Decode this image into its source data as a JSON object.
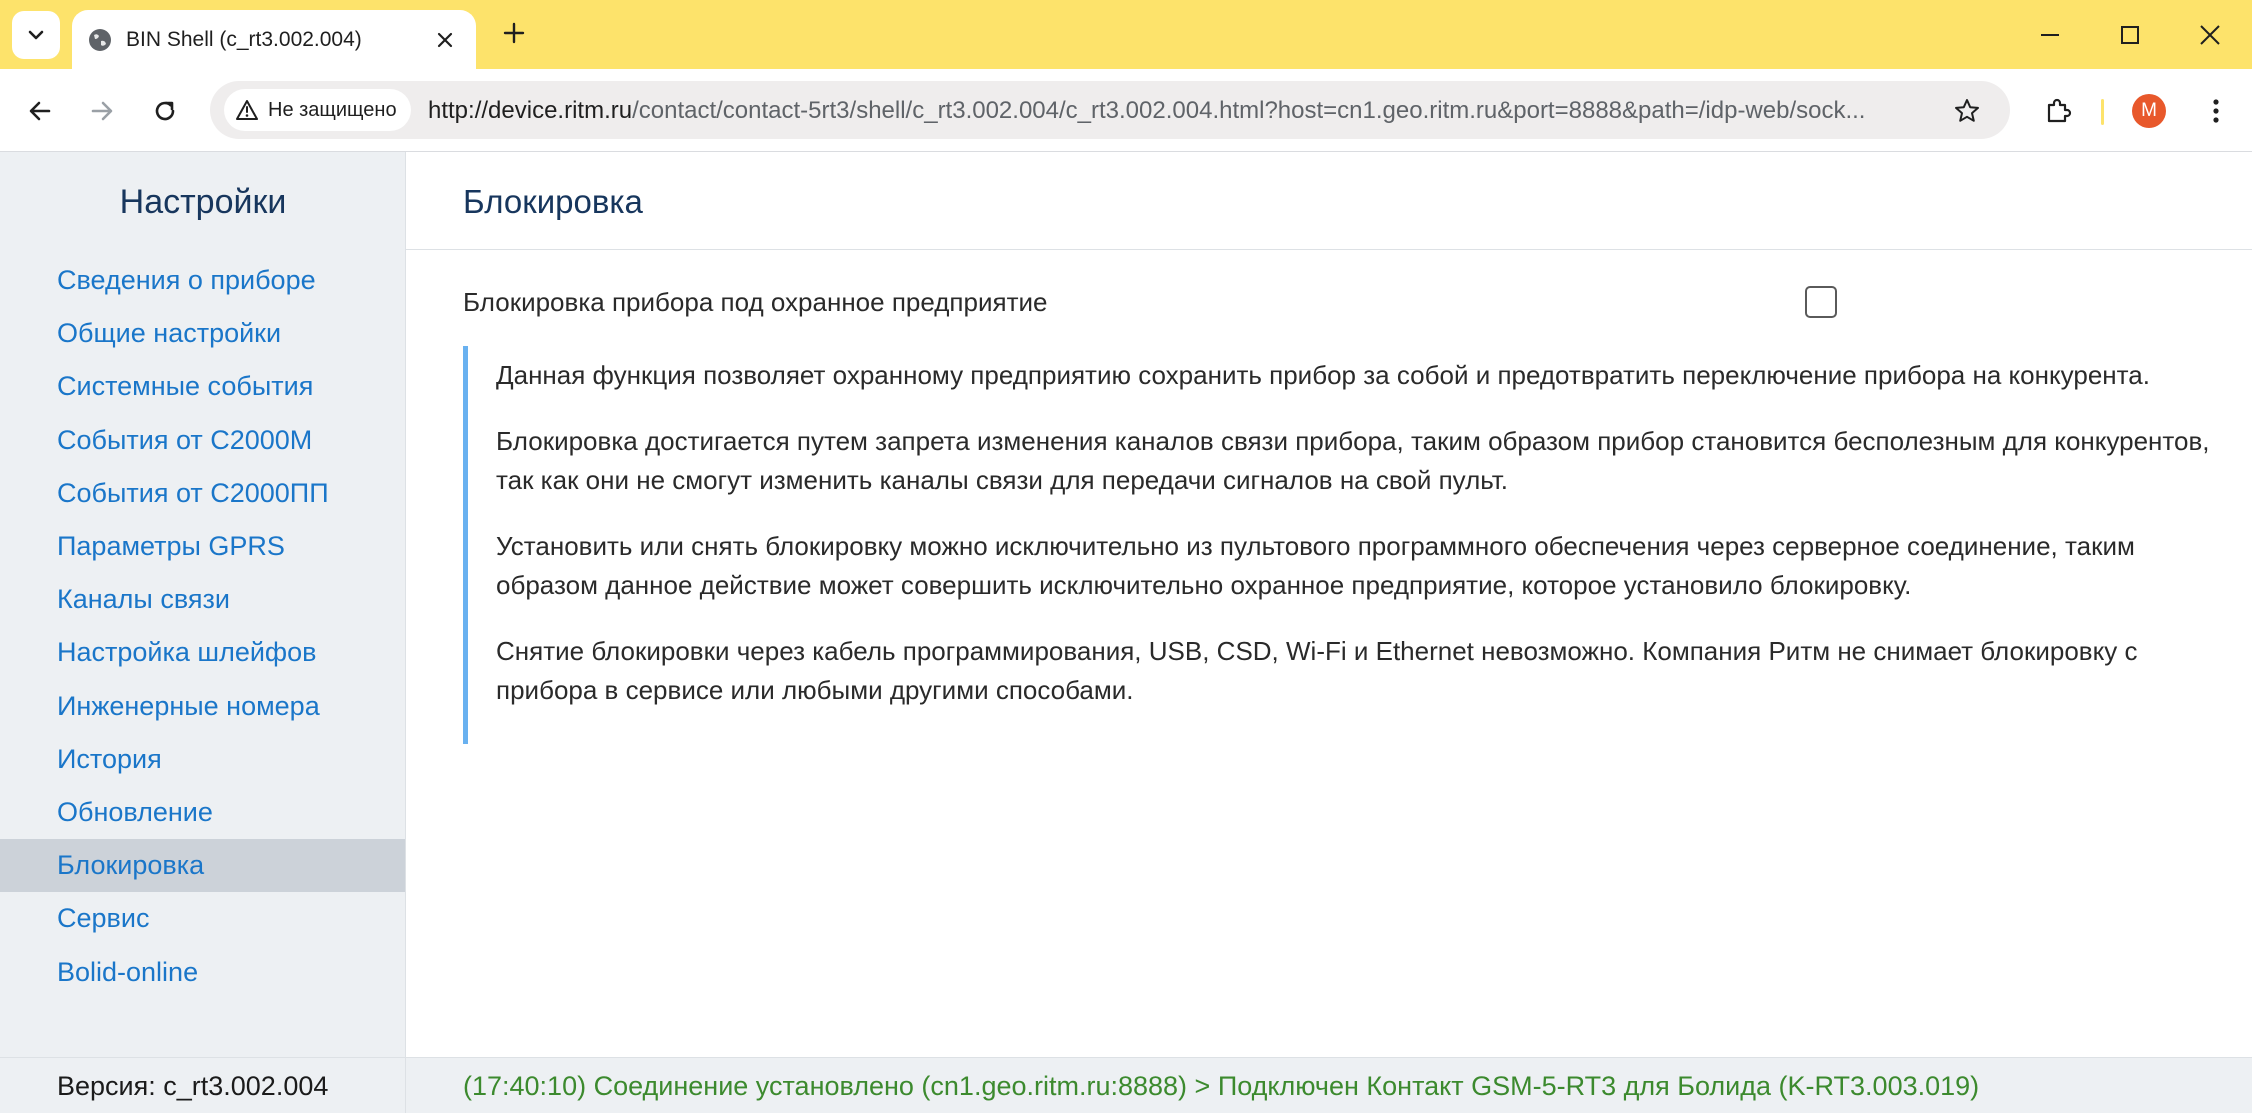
{
  "browser": {
    "tab_title": "BIN Shell (c_rt3.002.004)",
    "security_label": "Не защищено",
    "url_host": "http://device.ritm.ru",
    "url_path": "/contact/contact-5rt3/shell/c_rt3.002.004/c_rt3.002.004.html?host=cn1.geo.ritm.ru&port=8888&path=/idp-web/sock...",
    "avatar_letter": "M",
    "icons": [
      "tab-search-icon",
      "globe-icon",
      "close-icon",
      "plus-icon",
      "minimize-icon",
      "maximize-icon",
      "close-window-icon",
      "back-arrow-icon",
      "forward-arrow-icon",
      "reload-icon",
      "warning-icon",
      "star-icon",
      "extensions-icon",
      "more-vert-icon"
    ],
    "colors": {
      "tabbar": "#fde36b",
      "avatar": "#e8582b"
    }
  },
  "sidebar": {
    "title": "Настройки",
    "items": [
      {
        "label": "Сведения о приборе",
        "active": false
      },
      {
        "label": "Общие настройки",
        "active": false
      },
      {
        "label": "Системные события",
        "active": false
      },
      {
        "label": "События от С2000М",
        "active": false
      },
      {
        "label": "События от С2000ПП",
        "active": false
      },
      {
        "label": "Параметры GPRS",
        "active": false
      },
      {
        "label": "Каналы связи",
        "active": false
      },
      {
        "label": "Настройка шлейфов",
        "active": false
      },
      {
        "label": "Инженерные номера",
        "active": false
      },
      {
        "label": "История",
        "active": false
      },
      {
        "label": "Обновление",
        "active": false
      },
      {
        "label": "Блокировка",
        "active": true
      },
      {
        "label": "Сервис",
        "active": false
      },
      {
        "label": "Bolid-online",
        "active": false
      }
    ]
  },
  "main": {
    "title": "Блокировка",
    "setting": {
      "label": "Блокировка прибора под охранное предприятие",
      "checked": false
    },
    "info": [
      "Данная функция позволяет охранному предприятию сохранить прибор за собой и предотвратить переключение прибора на конкурента.",
      "Блокировка достигается путем запрета изменения каналов связи прибора, таким образом прибор становится бесполезным для конкурентов, так как они не смогут изменить каналы связи для передачи сигналов на свой пульт.",
      "Установить или снять блокировку можно исключительно из пультового программного обеспечения через серверное соединение, таким образом данное действие может совершить исключительно охранное предприятие, которое установило блокировку.",
      "Снятие блокировки через кабель программирования, USB, CSD, Wi-Fi и Ethernet невозможно. Компания Ритм не снимает блокировку с прибора в сервисе или любыми другими способами."
    ]
  },
  "status": {
    "version": "Версия: c_rt3.002.004",
    "connection": "(17:40:10) Соединение установлено (cn1.geo.ritm.ru:8888) > Подключен Контакт GSM-5-RT3 для Болида (K-RT3.003.019)",
    "connection_color": "#3c8a2e"
  }
}
